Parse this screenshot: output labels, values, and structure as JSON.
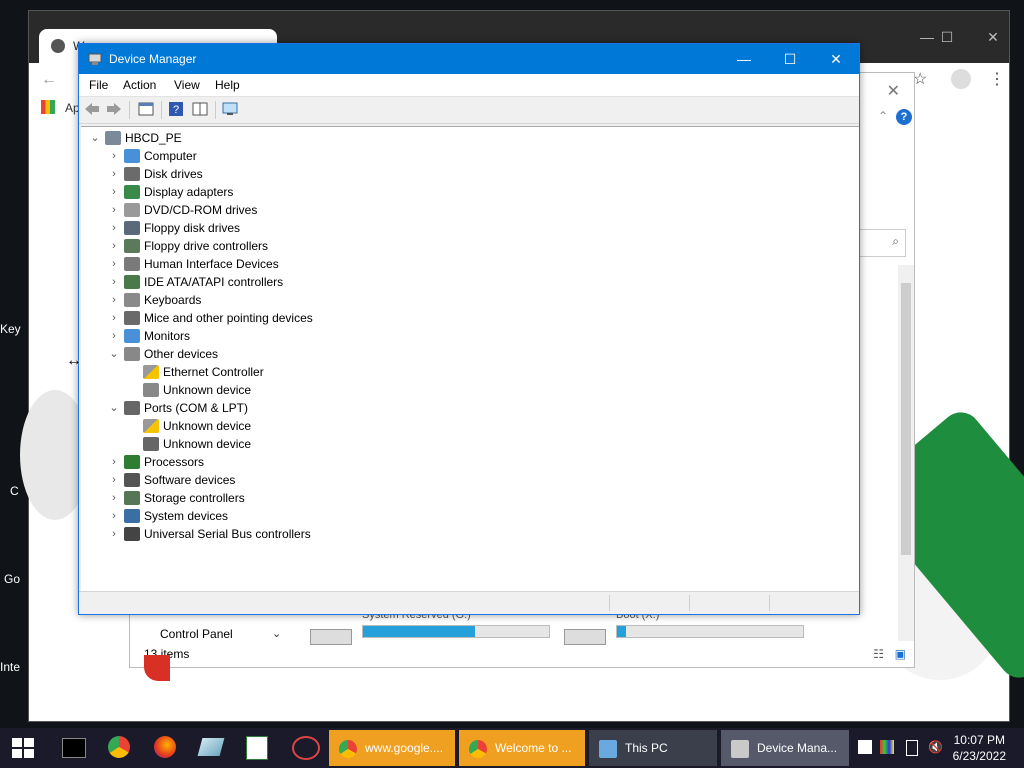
{
  "background_chrome": {
    "tab_title": "W...",
    "apps_label": "Ap"
  },
  "side_texts": [
    "Key",
    "C",
    "Go",
    "Inte"
  ],
  "this_pc": {
    "items_count": "13 items",
    "nav_control_panel": "Control Panel",
    "drives": [
      {
        "name": "System Reserved (G:)",
        "fill_fraction": 0.6
      },
      {
        "name": "Boot (X:)",
        "fill_fraction": 0.05
      }
    ]
  },
  "device_manager": {
    "title": "Device Manager",
    "menu": [
      "File",
      "Action",
      "View",
      "Help"
    ],
    "tree": [
      {
        "label": "HBCD_PE",
        "level": 0,
        "expanded": true,
        "icon": "computer-root-icon"
      },
      {
        "label": "Computer",
        "level": 1,
        "expanded": false,
        "icon": "monitor-icon"
      },
      {
        "label": "Disk drives",
        "level": 1,
        "expanded": false,
        "icon": "disk-icon"
      },
      {
        "label": "Display adapters",
        "level": 1,
        "expanded": false,
        "icon": "display-adapter-icon"
      },
      {
        "label": "DVD/CD-ROM drives",
        "level": 1,
        "expanded": false,
        "icon": "dvd-icon"
      },
      {
        "label": "Floppy disk drives",
        "level": 1,
        "expanded": false,
        "icon": "floppy-icon"
      },
      {
        "label": "Floppy drive controllers",
        "level": 1,
        "expanded": false,
        "icon": "floppy-controller-icon"
      },
      {
        "label": "Human Interface Devices",
        "level": 1,
        "expanded": false,
        "icon": "hid-icon"
      },
      {
        "label": "IDE ATA/ATAPI controllers",
        "level": 1,
        "expanded": false,
        "icon": "ide-icon"
      },
      {
        "label": "Keyboards",
        "level": 1,
        "expanded": false,
        "icon": "keyboard-icon"
      },
      {
        "label": "Mice and other pointing devices",
        "level": 1,
        "expanded": false,
        "icon": "mouse-icon"
      },
      {
        "label": "Monitors",
        "level": 1,
        "expanded": false,
        "icon": "monitor-icon"
      },
      {
        "label": "Other devices",
        "level": 1,
        "expanded": true,
        "icon": "unknown-device-icon"
      },
      {
        "label": "Ethernet Controller",
        "level": 2,
        "expanded": null,
        "icon": "warning-device-icon"
      },
      {
        "label": "Unknown device",
        "level": 2,
        "expanded": null,
        "icon": "unknown-device-icon"
      },
      {
        "label": "Ports (COM & LPT)",
        "level": 1,
        "expanded": true,
        "icon": "port-icon"
      },
      {
        "label": "Unknown device",
        "level": 2,
        "expanded": null,
        "icon": "warning-device-icon"
      },
      {
        "label": "Unknown device",
        "level": 2,
        "expanded": null,
        "icon": "port-icon"
      },
      {
        "label": "Processors",
        "level": 1,
        "expanded": false,
        "icon": "processor-icon"
      },
      {
        "label": "Software devices",
        "level": 1,
        "expanded": false,
        "icon": "software-device-icon"
      },
      {
        "label": "Storage controllers",
        "level": 1,
        "expanded": false,
        "icon": "storage-controller-icon"
      },
      {
        "label": "System devices",
        "level": 1,
        "expanded": false,
        "icon": "system-device-icon"
      },
      {
        "label": "Universal Serial Bus controllers",
        "level": 1,
        "expanded": false,
        "icon": "usb-icon"
      }
    ]
  },
  "taskbar": {
    "tasks": [
      {
        "label": "www.google....",
        "icon": "chrome-icon",
        "style": "orange"
      },
      {
        "label": "Welcome to ...",
        "icon": "chrome-icon",
        "style": "orange"
      },
      {
        "label": "This PC",
        "icon": "this-pc-icon",
        "style": "dark"
      },
      {
        "label": "Device Mana...",
        "icon": "device-manager-icon",
        "style": "active"
      }
    ],
    "time": "10:07 PM",
    "date": "6/23/2022"
  }
}
